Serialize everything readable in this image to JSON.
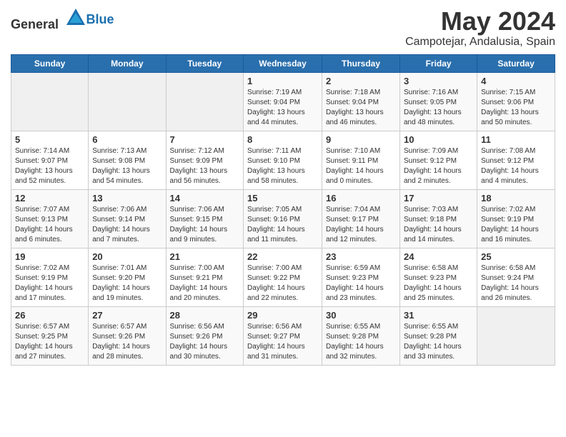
{
  "logo": {
    "general": "General",
    "blue": "Blue"
  },
  "title": {
    "month_year": "May 2024",
    "location": "Campotejar, Andalusia, Spain"
  },
  "headers": [
    "Sunday",
    "Monday",
    "Tuesday",
    "Wednesday",
    "Thursday",
    "Friday",
    "Saturday"
  ],
  "weeks": [
    [
      {
        "day": "",
        "info": ""
      },
      {
        "day": "",
        "info": ""
      },
      {
        "day": "",
        "info": ""
      },
      {
        "day": "1",
        "info": "Sunrise: 7:19 AM\nSunset: 9:04 PM\nDaylight: 13 hours\nand 44 minutes."
      },
      {
        "day": "2",
        "info": "Sunrise: 7:18 AM\nSunset: 9:04 PM\nDaylight: 13 hours\nand 46 minutes."
      },
      {
        "day": "3",
        "info": "Sunrise: 7:16 AM\nSunset: 9:05 PM\nDaylight: 13 hours\nand 48 minutes."
      },
      {
        "day": "4",
        "info": "Sunrise: 7:15 AM\nSunset: 9:06 PM\nDaylight: 13 hours\nand 50 minutes."
      }
    ],
    [
      {
        "day": "5",
        "info": "Sunrise: 7:14 AM\nSunset: 9:07 PM\nDaylight: 13 hours\nand 52 minutes."
      },
      {
        "day": "6",
        "info": "Sunrise: 7:13 AM\nSunset: 9:08 PM\nDaylight: 13 hours\nand 54 minutes."
      },
      {
        "day": "7",
        "info": "Sunrise: 7:12 AM\nSunset: 9:09 PM\nDaylight: 13 hours\nand 56 minutes."
      },
      {
        "day": "8",
        "info": "Sunrise: 7:11 AM\nSunset: 9:10 PM\nDaylight: 13 hours\nand 58 minutes."
      },
      {
        "day": "9",
        "info": "Sunrise: 7:10 AM\nSunset: 9:11 PM\nDaylight: 14 hours\nand 0 minutes."
      },
      {
        "day": "10",
        "info": "Sunrise: 7:09 AM\nSunset: 9:12 PM\nDaylight: 14 hours\nand 2 minutes."
      },
      {
        "day": "11",
        "info": "Sunrise: 7:08 AM\nSunset: 9:12 PM\nDaylight: 14 hours\nand 4 minutes."
      }
    ],
    [
      {
        "day": "12",
        "info": "Sunrise: 7:07 AM\nSunset: 9:13 PM\nDaylight: 14 hours\nand 6 minutes."
      },
      {
        "day": "13",
        "info": "Sunrise: 7:06 AM\nSunset: 9:14 PM\nDaylight: 14 hours\nand 7 minutes."
      },
      {
        "day": "14",
        "info": "Sunrise: 7:06 AM\nSunset: 9:15 PM\nDaylight: 14 hours\nand 9 minutes."
      },
      {
        "day": "15",
        "info": "Sunrise: 7:05 AM\nSunset: 9:16 PM\nDaylight: 14 hours\nand 11 minutes."
      },
      {
        "day": "16",
        "info": "Sunrise: 7:04 AM\nSunset: 9:17 PM\nDaylight: 14 hours\nand 12 minutes."
      },
      {
        "day": "17",
        "info": "Sunrise: 7:03 AM\nSunset: 9:18 PM\nDaylight: 14 hours\nand 14 minutes."
      },
      {
        "day": "18",
        "info": "Sunrise: 7:02 AM\nSunset: 9:19 PM\nDaylight: 14 hours\nand 16 minutes."
      }
    ],
    [
      {
        "day": "19",
        "info": "Sunrise: 7:02 AM\nSunset: 9:19 PM\nDaylight: 14 hours\nand 17 minutes."
      },
      {
        "day": "20",
        "info": "Sunrise: 7:01 AM\nSunset: 9:20 PM\nDaylight: 14 hours\nand 19 minutes."
      },
      {
        "day": "21",
        "info": "Sunrise: 7:00 AM\nSunset: 9:21 PM\nDaylight: 14 hours\nand 20 minutes."
      },
      {
        "day": "22",
        "info": "Sunrise: 7:00 AM\nSunset: 9:22 PM\nDaylight: 14 hours\nand 22 minutes."
      },
      {
        "day": "23",
        "info": "Sunrise: 6:59 AM\nSunset: 9:23 PM\nDaylight: 14 hours\nand 23 minutes."
      },
      {
        "day": "24",
        "info": "Sunrise: 6:58 AM\nSunset: 9:23 PM\nDaylight: 14 hours\nand 25 minutes."
      },
      {
        "day": "25",
        "info": "Sunrise: 6:58 AM\nSunset: 9:24 PM\nDaylight: 14 hours\nand 26 minutes."
      }
    ],
    [
      {
        "day": "26",
        "info": "Sunrise: 6:57 AM\nSunset: 9:25 PM\nDaylight: 14 hours\nand 27 minutes."
      },
      {
        "day": "27",
        "info": "Sunrise: 6:57 AM\nSunset: 9:26 PM\nDaylight: 14 hours\nand 28 minutes."
      },
      {
        "day": "28",
        "info": "Sunrise: 6:56 AM\nSunset: 9:26 PM\nDaylight: 14 hours\nand 30 minutes."
      },
      {
        "day": "29",
        "info": "Sunrise: 6:56 AM\nSunset: 9:27 PM\nDaylight: 14 hours\nand 31 minutes."
      },
      {
        "day": "30",
        "info": "Sunrise: 6:55 AM\nSunset: 9:28 PM\nDaylight: 14 hours\nand 32 minutes."
      },
      {
        "day": "31",
        "info": "Sunrise: 6:55 AM\nSunset: 9:28 PM\nDaylight: 14 hours\nand 33 minutes."
      },
      {
        "day": "",
        "info": ""
      }
    ]
  ]
}
